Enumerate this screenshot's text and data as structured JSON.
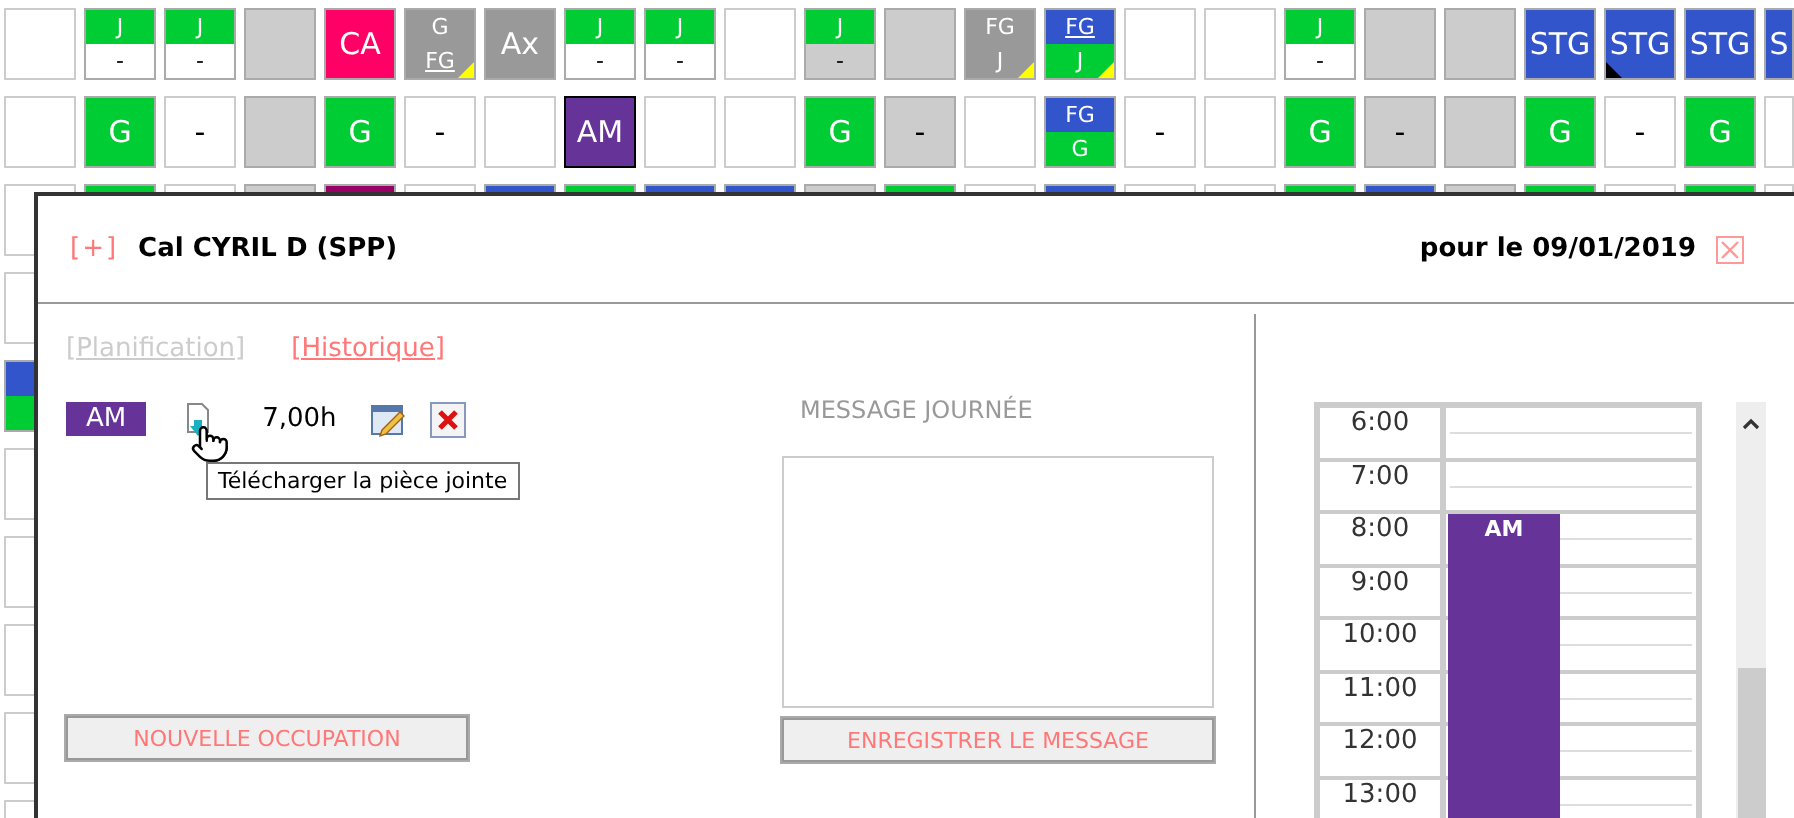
{
  "grid": {
    "rows": [
      {
        "cells": [
          {
            "kind": "single",
            "color": "#ffffff",
            "selected": false
          },
          {
            "kind": "split",
            "selected": false,
            "top": {
              "text": "J",
              "color": "#00cc33",
              "underlined": false
            },
            "bottom": {
              "text": "-",
              "color": "#ffffff",
              "underlined": false
            }
          },
          {
            "kind": "split",
            "selected": false,
            "top": {
              "text": "J",
              "color": "#00cc33",
              "underlined": false
            },
            "bottom": {
              "text": "-",
              "color": "#ffffff",
              "underlined": false
            }
          },
          {
            "kind": "single",
            "color": "#cccccc",
            "selected": false
          },
          {
            "kind": "single",
            "color": "#ff0066",
            "text": "CA",
            "selected": false
          },
          {
            "kind": "split",
            "selected": false,
            "marker": {
              "kind": "alert"
            },
            "top": {
              "text": "G",
              "color": "#999999",
              "underlined": false
            },
            "bottom": {
              "text": "FG",
              "color": "#999999",
              "underlined": true
            }
          },
          {
            "kind": "single",
            "color": "#999999",
            "text": "Ax",
            "selected": false
          },
          {
            "kind": "split",
            "selected": false,
            "top": {
              "text": "J",
              "color": "#00cc33",
              "underlined": false
            },
            "bottom": {
              "text": "-",
              "color": "#ffffff",
              "underlined": false
            }
          },
          {
            "kind": "split",
            "selected": false,
            "top": {
              "text": "J",
              "color": "#00cc33",
              "underlined": false
            },
            "bottom": {
              "text": "-",
              "color": "#ffffff",
              "underlined": false
            }
          },
          {
            "kind": "single",
            "color": "#ffffff",
            "selected": false
          },
          {
            "kind": "split",
            "selected": false,
            "top": {
              "text": "J",
              "color": "#00cc33",
              "underlined": false
            },
            "bottom": {
              "text": "-",
              "color": "#cccccc",
              "underlined": false
            }
          },
          {
            "kind": "single",
            "color": "#cccccc",
            "selected": false
          },
          {
            "kind": "split",
            "selected": false,
            "marker": {
              "kind": "alert"
            },
            "top": {
              "text": "FG",
              "color": "#999999",
              "underlined": false
            },
            "bottom": {
              "text": "J",
              "color": "#999999",
              "underlined": false
            }
          },
          {
            "kind": "split",
            "selected": false,
            "marker": {
              "kind": "alert"
            },
            "top": {
              "text": "FG",
              "color": "#3355cc",
              "underlined": true
            },
            "bottom": {
              "text": "J",
              "color": "#00cc33",
              "underlined": false
            }
          },
          {
            "kind": "single",
            "color": "#ffffff",
            "selected": false
          },
          {
            "kind": "single",
            "color": "#ffffff",
            "selected": false
          },
          {
            "kind": "split",
            "selected": false,
            "top": {
              "text": "J",
              "color": "#00cc33",
              "underlined": false
            },
            "bottom": {
              "text": "-",
              "color": "#ffffff",
              "underlined": false
            }
          },
          {
            "kind": "single",
            "color": "#cccccc",
            "selected": false
          },
          {
            "kind": "single",
            "color": "#cccccc",
            "selected": false
          },
          {
            "kind": "single",
            "color": "#3355cc",
            "text": "STG",
            "selected": false
          },
          {
            "kind": "single",
            "color": "#3355cc",
            "text": "STG",
            "selected": false,
            "marker": {
              "kind": "note"
            }
          },
          {
            "kind": "single",
            "color": "#3355cc",
            "text": "STG",
            "selected": false
          },
          {
            "kind": "single",
            "color": "#3355cc",
            "text": "S",
            "selected": false
          }
        ]
      },
      {
        "cells": [
          {
            "kind": "single",
            "color": "#ffffff",
            "selected": false
          },
          {
            "kind": "single",
            "color": "#00cc33",
            "text": "G",
            "selected": false
          },
          {
            "kind": "single",
            "color": "#ffffff",
            "text": "-",
            "selected": false
          },
          {
            "kind": "single",
            "color": "#cccccc",
            "selected": false
          },
          {
            "kind": "single",
            "color": "#00cc33",
            "text": "G",
            "selected": false
          },
          {
            "kind": "single",
            "color": "#ffffff",
            "text": "-",
            "selected": false
          },
          {
            "kind": "single",
            "color": "#ffffff",
            "selected": false
          },
          {
            "kind": "single",
            "color": "#663399",
            "text": "AM",
            "selected": true
          },
          {
            "kind": "single",
            "color": "#ffffff",
            "selected": false
          },
          {
            "kind": "single",
            "color": "#ffffff",
            "selected": false
          },
          {
            "kind": "single",
            "color": "#00cc33",
            "text": "G",
            "selected": false
          },
          {
            "kind": "single",
            "color": "#cccccc",
            "text": "-",
            "selected": false
          },
          {
            "kind": "single",
            "color": "#ffffff",
            "selected": false
          },
          {
            "kind": "split",
            "selected": false,
            "top": {
              "text": "FG",
              "color": "#3355cc",
              "underlined": false
            },
            "bottom": {
              "text": "G",
              "color": "#00cc33",
              "underlined": false
            }
          },
          {
            "kind": "single",
            "color": "#ffffff",
            "text": "-",
            "selected": false
          },
          {
            "kind": "single",
            "color": "#ffffff",
            "selected": false
          },
          {
            "kind": "single",
            "color": "#00cc33",
            "text": "G",
            "selected": false
          },
          {
            "kind": "single",
            "color": "#cccccc",
            "text": "-",
            "selected": false
          },
          {
            "kind": "single",
            "color": "#cccccc",
            "selected": false
          },
          {
            "kind": "single",
            "color": "#00cc33",
            "text": "G",
            "selected": false
          },
          {
            "kind": "single",
            "color": "#ffffff",
            "text": "-",
            "selected": false
          },
          {
            "kind": "single",
            "color": "#00cc33",
            "text": "G",
            "selected": false
          },
          {
            "kind": "single",
            "color": "#ffffff",
            "selected": false
          }
        ]
      },
      {
        "cells": [
          {
            "kind": "single",
            "color": "#ffffff",
            "selected": false
          },
          {
            "kind": "single",
            "color": "#00cc33",
            "selected": false
          },
          {
            "kind": "single",
            "color": "#ffffff",
            "selected": false
          },
          {
            "kind": "single",
            "color": "#cccccc",
            "selected": false
          },
          {
            "kind": "single",
            "color": "#990066",
            "selected": false
          },
          {
            "kind": "single",
            "color": "#ffffff",
            "selected": false
          },
          {
            "kind": "single",
            "color": "#3355cc",
            "selected": false
          },
          {
            "kind": "single",
            "color": "#00cc33",
            "selected": false
          },
          {
            "kind": "single",
            "color": "#3355cc",
            "selected": false
          },
          {
            "kind": "single",
            "color": "#3355cc",
            "selected": false
          },
          {
            "kind": "single",
            "color": "#cccccc",
            "selected": false
          },
          {
            "kind": "single",
            "color": "#00cc33",
            "selected": false
          },
          {
            "kind": "single",
            "color": "#ffffff",
            "selected": false
          },
          {
            "kind": "single",
            "color": "#3355cc",
            "selected": false
          },
          {
            "kind": "single",
            "color": "#ffffff",
            "selected": false
          },
          {
            "kind": "single",
            "color": "#ffffff",
            "selected": false
          },
          {
            "kind": "single",
            "color": "#00cc33",
            "selected": false
          },
          {
            "kind": "single",
            "color": "#3355cc",
            "selected": false
          },
          {
            "kind": "single",
            "color": "#cccccc",
            "selected": false
          },
          {
            "kind": "single",
            "color": "#00cc33",
            "selected": false
          },
          {
            "kind": "single",
            "color": "#ffffff",
            "selected": false
          },
          {
            "kind": "single",
            "color": "#00cc33",
            "selected": false
          },
          {
            "kind": "single",
            "color": "#ffffff",
            "selected": false
          }
        ]
      },
      {
        "cells": [
          {
            "kind": "single",
            "color": "#ffffff",
            "selected": false
          }
        ]
      },
      {
        "cells": [
          {
            "kind": "split",
            "selected": false,
            "top": {
              "color": "#3355cc"
            },
            "bottom": {
              "color": "#00cc33"
            }
          }
        ]
      },
      {
        "cells": [
          {
            "kind": "single",
            "color": "#ffffff",
            "selected": false
          }
        ]
      },
      {
        "cells": [
          {
            "kind": "single",
            "color": "#ffffff",
            "selected": false
          }
        ]
      },
      {
        "cells": [
          {
            "kind": "single",
            "color": "#ffffff",
            "selected": false
          }
        ]
      },
      {
        "cells": [
          {
            "kind": "single",
            "color": "#ffffff",
            "selected": false
          }
        ]
      },
      {
        "cells": [
          {
            "kind": "single",
            "color": "#ffffff",
            "selected": false
          }
        ]
      }
    ]
  },
  "dialog": {
    "expand": "[+]",
    "title": "Cal CYRIL D (SPP)",
    "date": "pour le 09/01/2019",
    "links": [
      {
        "label": "[Planification]",
        "selected": false
      },
      {
        "label": "[Historique]",
        "selected": true
      }
    ],
    "occupation": {
      "badge": "AM",
      "hours": "7,00h"
    },
    "tooltip": "Télécharger la pièce jointe",
    "message_label": "MESSAGE JOURNÉE",
    "new_button": "NOUVELLE OCCUPATION",
    "save_button": "ENREGISTRER LE MESSAGE",
    "schedule": {
      "hours": [
        {
          "label": "6:00"
        },
        {
          "label": "7:00"
        },
        {
          "label": "8:00",
          "event": "AM"
        },
        {
          "label": "9:00"
        },
        {
          "label": "10:00"
        },
        {
          "label": "11:00"
        },
        {
          "label": "12:00"
        },
        {
          "label": "13:00"
        }
      ]
    }
  }
}
